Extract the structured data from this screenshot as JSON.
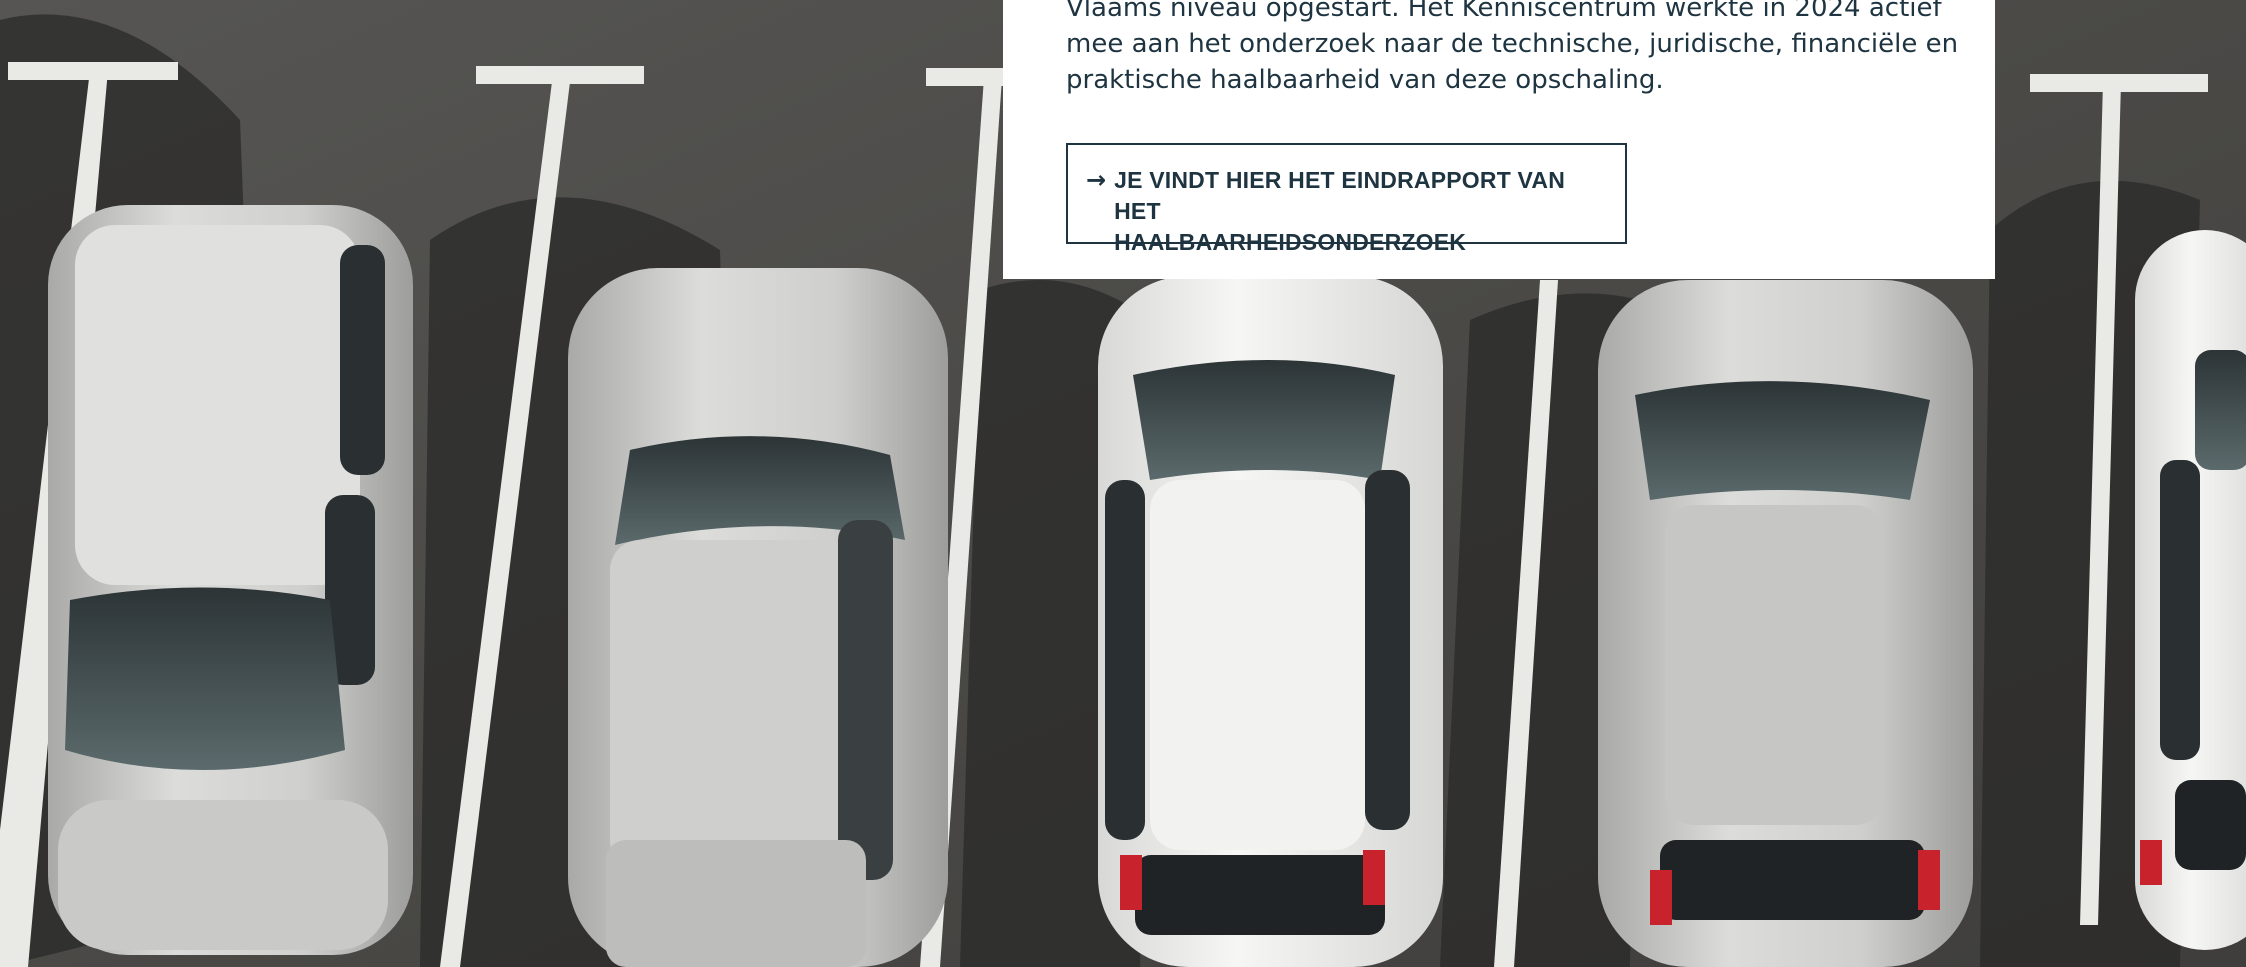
{
  "intro": {
    "lines": [
      "Vlaams niveau opgestart. Het Kenniscentrum werkte in 2024 actief",
      "mee aan het onderzoek naar de technische, juridische, financiële en",
      "praktische haalbaarheid van deze opschaling."
    ]
  },
  "cta": {
    "arrow": "→",
    "lines": [
      "JE VINDT HIER HET EINDRAPPORT VAN HET",
      "HAALBAARHEIDSONDERZOEK"
    ]
  },
  "photo": {
    "subject": "aerial-view-parked-cars",
    "colors": {
      "asphalt": "#4a4a48",
      "lines": "#e9e9e6",
      "text": "#1e3440"
    }
  }
}
